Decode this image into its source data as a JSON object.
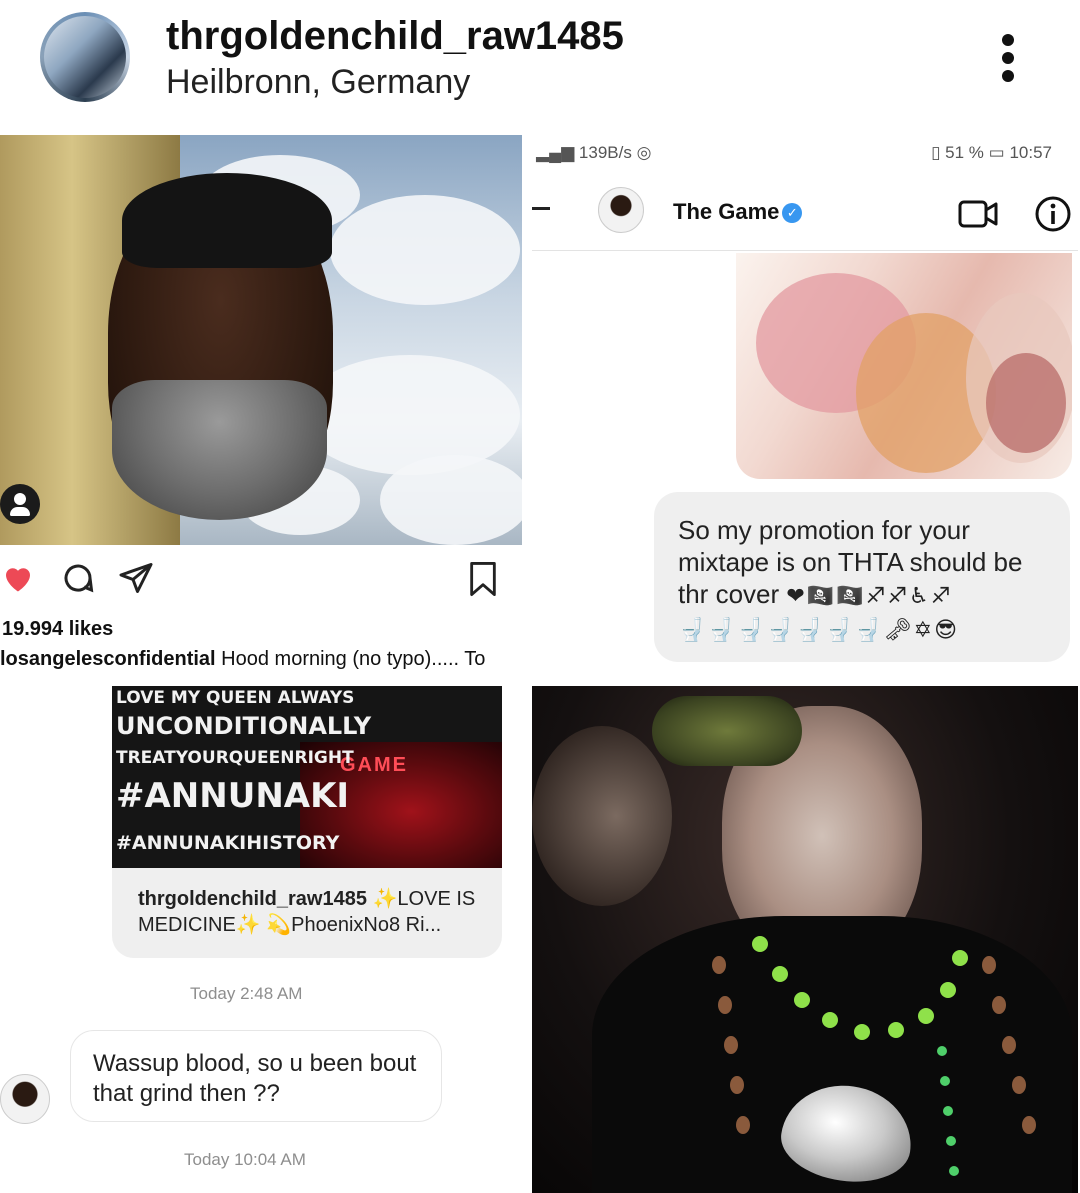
{
  "header": {
    "username": "thrgoldenchild_raw1485",
    "location": "Heilbronn, Germany"
  },
  "post": {
    "likes": "19.994 likes",
    "caption_user": "losangelesconfidential",
    "caption_text": "Hood morning (no typo)..... To"
  },
  "dm_top": {
    "status_left": "139B/s",
    "status_battery": "51 %",
    "status_time": "10:57",
    "contact_name": "The Game",
    "message_text": "So my promotion for your mixtape is on THTA should be thr cover",
    "message_emojis_1": "❤🏴‍☠️🏴‍☠️♐♐♿♐",
    "message_emojis_2": "🚽🚽🚽🚽🚽🚽🚽🗝✡😎"
  },
  "dm_bottom": {
    "shared_lines": [
      "LOVE MY QUEEN ALWAYS",
      "UNCONDITIONALLY",
      "TREATYOURQUEENRIGHT",
      "#ANNUNAKI",
      "#ANNUNAKIHISTORY"
    ],
    "album_label": "GAME",
    "shared_user": "thrgoldenchild_raw1485",
    "shared_caption": "✨LOVE IS MEDICINE✨ 💫PhoenixNo8 Ri...",
    "timestamp_1": "Today 2:48 AM",
    "message_text": "Wassup blood, so u been bout that grind then ??",
    "timestamp_2": "Today 10:04 AM"
  },
  "colors": {
    "heart": "#ed4956",
    "verified": "#3897f0",
    "bubble": "#efefef"
  },
  "icons": [
    "kebab-menu-icon",
    "person-tag-icon",
    "heart-icon",
    "comment-icon",
    "share-icon",
    "bookmark-icon",
    "video-call-icon",
    "info-icon"
  ]
}
